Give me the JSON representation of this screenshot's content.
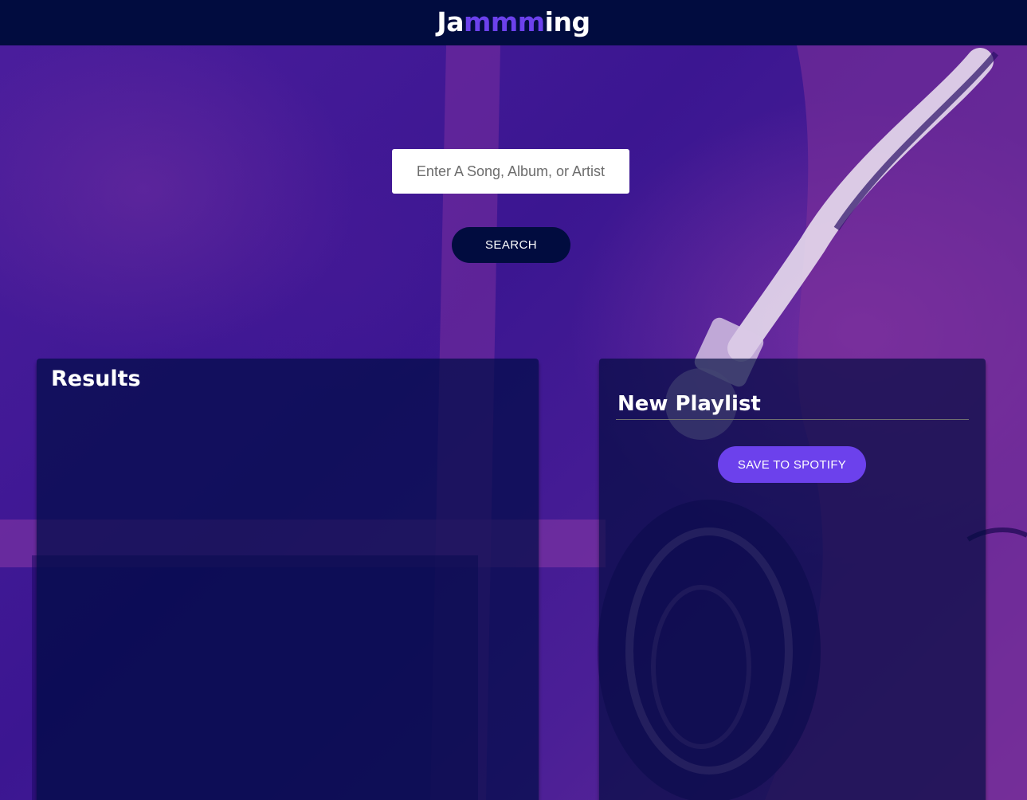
{
  "header": {
    "logo_prefix": "Ja",
    "logo_accent": "mmm",
    "logo_suffix": "ing"
  },
  "search": {
    "placeholder": "Enter A Song, Album, or Artist",
    "value": "",
    "button_label": "SEARCH"
  },
  "results": {
    "title": "Results",
    "tracks": []
  },
  "playlist": {
    "name": "New Playlist",
    "save_label": "SAVE TO SPOTIFY",
    "tracks": []
  },
  "colors": {
    "header_bg": "#010c3f",
    "accent": "#6c41ec",
    "background": "#3a1790"
  },
  "icons": {
    "background_art": "headphones-photo"
  }
}
